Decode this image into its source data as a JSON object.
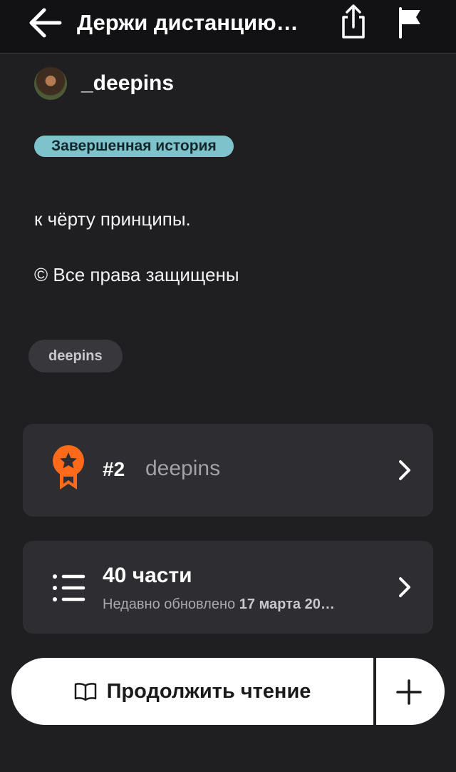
{
  "header": {
    "title": "Держи дистанцию…",
    "icons": {
      "back": "arrow-left-icon",
      "share": "share-icon",
      "report": "flag-icon"
    }
  },
  "author": {
    "name": "_deepins"
  },
  "story": {
    "status_badge": "Завершенная история",
    "description_lines": [
      "к чёрту принципы.",
      "© Все права защищены"
    ],
    "tags": [
      "deepins"
    ]
  },
  "ranking": {
    "rank": "#2",
    "tag": "deepins",
    "icon": "award-ribbon-icon"
  },
  "parts": {
    "count_label": "40 части",
    "updated_prefix": "Недавно обновлено",
    "updated_date": "17 марта 20…",
    "icon": "list-icon"
  },
  "actions": {
    "continue_reading_label": "Продолжить чтение",
    "continue_icon": "book-open-icon",
    "add_icon": "plus-icon"
  },
  "colors": {
    "background": "#1f1e21",
    "topbar": "#121113",
    "card": "#2e2d31",
    "badge": "#7ec3cb",
    "rank_accent": "#ff6a1a"
  }
}
